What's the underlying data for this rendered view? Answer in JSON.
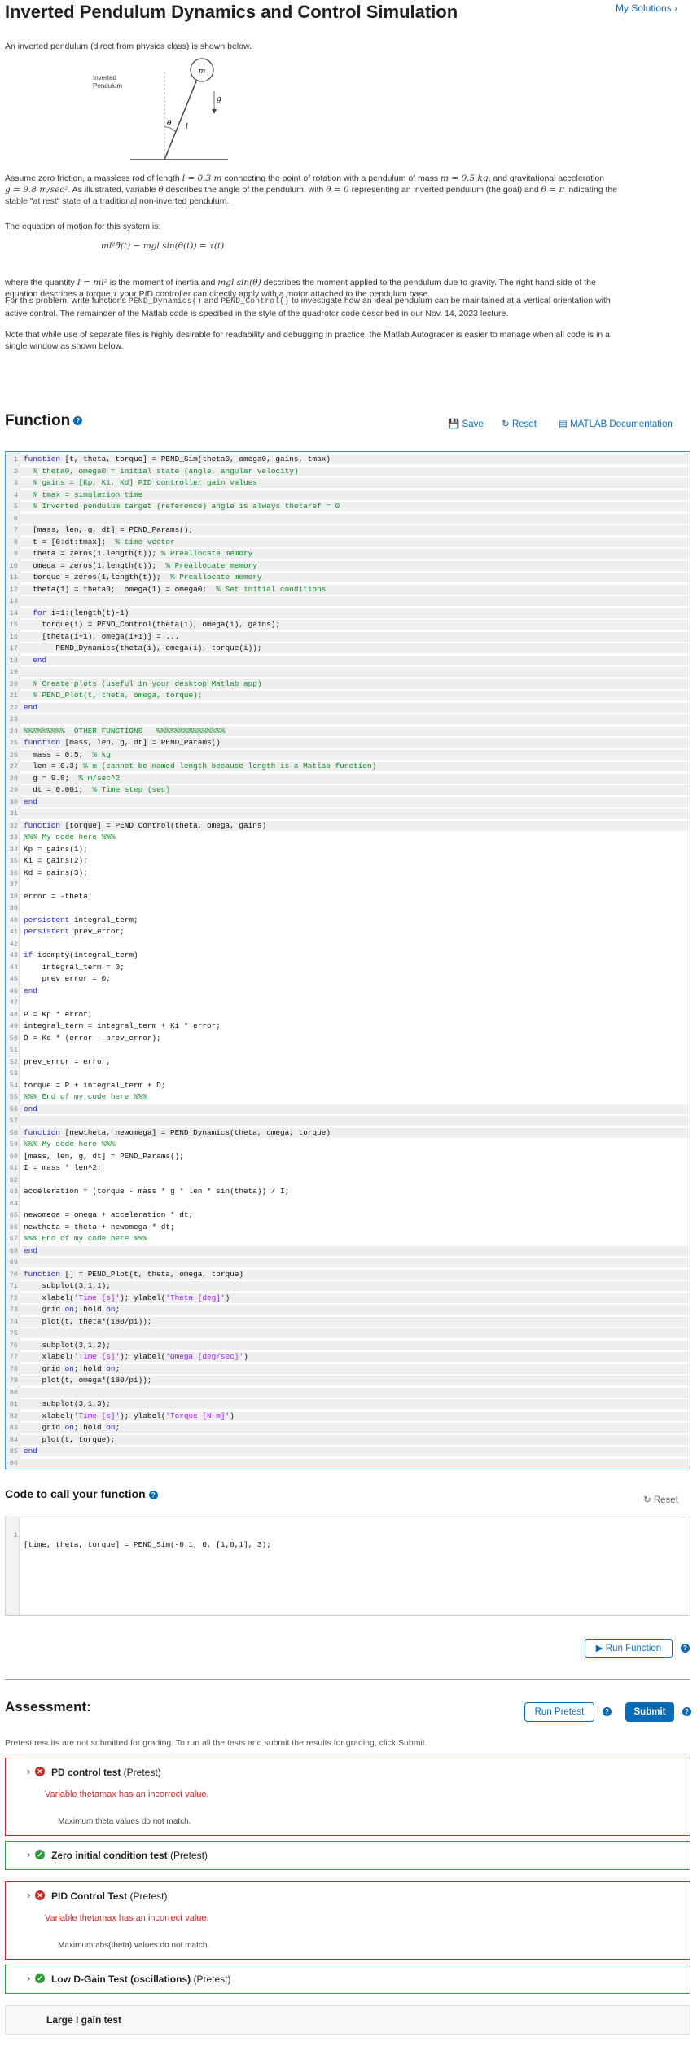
{
  "header": {
    "title": "Inverted Pendulum Dynamics and Control Simulation",
    "my_solutions": "My Solutions ›"
  },
  "intro": {
    "p1": "An inverted pendulum (direct from physics class) is shown below.",
    "figure_label": "Inverted\nPendulum",
    "fig_m": "m",
    "fig_g": "g",
    "fig_theta": "θ",
    "fig_l": "l",
    "p2a": "Assume zero friction, a massless rod of length ",
    "p2b": "l = 0.3 m",
    "p2c": " connecting the point of rotation with a pendulum of mass ",
    "p2d": "m = 0.5 kg",
    "p2e": ", and gravitational acceleration",
    "p2f": "g = 9.8 m/sec²",
    "p2g": ". As illustrated, variable ",
    "p2h": "θ",
    "p2i": " describes the angle of the pendulum, with ",
    "p2j": "θ = 0",
    "p2k": " representing an inverted pendulum (the goal) and ",
    "p2l": "θ = π",
    "p2m": " indicating the",
    "p2n": "stable \"at rest\" state of a traditional non-inverted pendulum.",
    "p3": "The  equation of motion for this system is:",
    "equation": "ml²θ̈(t) − mgl sin(θ(t)) = τ(t)",
    "p4a": "where the quantity ",
    "p4b": "I = ml²",
    "p4c": " is the moment of inertia and ",
    "p4d": "mgl sin(θ)",
    "p4e": " describes the moment applied to the pendulum due to gravity.  The right hand side of the",
    "p4f": "equation describes a torque ",
    "p4g": "τ",
    "p4h": " your PID controller can directly apply with a motor attached to the pendulum base.",
    "p5a": "For this problem, write functions ",
    "p5b": "PEND_Dynamics()",
    "p5c": " and ",
    "p5d": "PEND_Control()",
    "p5e": " to investigate how an ideal pendulum can be maintained at a vertical orientation with",
    "p5f": "active control.  The remainder of the Matlab code is specified in the style of the quadrotor code described in our Nov. 14, 2023 lecture.",
    "p6a": "Note that while use of separate files is highly desirable for readability and debugging in practice, the Matlab Autograder is easier to manage when all code is in a",
    "p6b": "single window as shown below."
  },
  "function_section": {
    "heading": "Function",
    "save": "Save",
    "reset": "Reset",
    "docs": "MATLAB Documentation"
  },
  "code_lines": [
    "function [t, theta, torque] = PEND_Sim(theta0, omega0, gains, tmax)",
    "  % theta0, omega0 = initial state (angle, angular velocity)",
    "  % gains = [Kp, Ki, Kd] PID controller gain values",
    "  % tmax = simulation time",
    "  % Inverted pendulum target (reference) angle is always thetaref = 0",
    "",
    "  [mass, len, g, dt] = PEND_Params();",
    "  t = [0:dt:tmax];  % time vector",
    "  theta = zeros(1,length(t)); % Preallocate memory",
    "  omega = zeros(1,length(t));  % Preallocate memory",
    "  torque = zeros(1,length(t));  % Preallocate memory",
    "  theta(1) = theta0;  omega(1) = omega0;  % Set initial conditions",
    "",
    "  for i=1:(length(t)-1)",
    "    torque(i) = PEND_Control(theta(i), omega(i), gains);",
    "    [theta(i+1), omega(i+1)] = ...",
    "       PEND_Dynamics(theta(i), omega(i), torque(i));",
    "  end",
    "",
    "  % Create plots (useful in your desktop Matlab app)",
    "  % PEND_Plot(t, theta, omega, torque);",
    "end",
    "",
    "%%%%%%%%%  OTHER FUNCTIONS   %%%%%%%%%%%%%%%",
    "function [mass, len, g, dt] = PEND_Params()",
    "  mass = 0.5;  % kg",
    "  len = 0.3; % m (cannot be named length because length is a Matlab function)",
    "  g = 9.8;  % m/sec^2",
    "  dt = 0.001;  % Time step (sec)",
    "end",
    "",
    "function [torque] = PEND_Control(theta, omega, gains)",
    "%%% My code here %%%",
    "Kp = gains(1);",
    "Ki = gains(2);",
    "Kd = gains(3);",
    "",
    "error = -theta;",
    "",
    "persistent integral_term;",
    "persistent prev_error;",
    "",
    "if isempty(integral_term)",
    "    integral_term = 0;",
    "    prev_error = 0;",
    "end",
    "",
    "P = Kp * error;",
    "integral_term = integral_term + Ki * error;",
    "D = Kd * (error - prev_error);",
    "",
    "prev_error = error;",
    "",
    "torque = P + integral_term + D;",
    "%%% End of my code here %%%",
    "end",
    "",
    "function [newtheta, newomega] = PEND_Dynamics(theta, omega, torque)",
    "%%% My code here %%%",
    "[mass, len, g, dt] = PEND_Params();",
    "I = mass * len^2;",
    "",
    "acceleration = (torque - mass * g * len * sin(theta)) / I;",
    "",
    "newomega = omega + acceleration * dt;",
    "newtheta = theta + newomega * dt;",
    "%%% End of my code here %%%",
    "end",
    "",
    "function [] = PEND_Plot(t, theta, omega, torque)",
    "    subplot(3,1,1);",
    "    xlabel('Time [s]'); ylabel('Theta [deg]')",
    "    grid on; hold on;",
    "    plot(t, theta*(180/pi));",
    "",
    "    subplot(3,1,2);",
    "    xlabel('Time [s]'); ylabel('Omega [deg/sec]')",
    "    grid on; hold on;",
    "    plot(t, omega*(180/pi));",
    "",
    "    subplot(3,1,3);",
    "    xlabel('Time [s]'); ylabel('Torque [N-m]')",
    "    grid on; hold on;",
    "    plot(t, torque);",
    "end",
    ""
  ],
  "readonly_ranges": [
    [
      1,
      32
    ],
    [
      56,
      58
    ],
    [
      68,
      86
    ]
  ],
  "call_section": {
    "heading": "Code to call your function",
    "reset": "Reset",
    "line": "[time, theta, torque] = PEND_Sim(-0.1, 0, [1,0,1], 3);",
    "line_number": "1",
    "run_button": "▶ Run Function"
  },
  "assessment": {
    "heading": "Assessment:",
    "run_pretest": "Run Pretest",
    "submit": "Submit",
    "note": "Pretest results are not submitted for grading. To run all the tests and submit the results for grading, click Submit.",
    "tests": [
      {
        "name": "PD control test",
        "tag": "(Pretest)",
        "status": "fail",
        "error": "Variable thetamax has an incorrect value.",
        "detail": "Maximum theta values do not match."
      },
      {
        "name": "Zero initial condition test",
        "tag": "(Pretest)",
        "status": "pass"
      },
      {
        "name": "PID Control Test",
        "tag": "(Pretest)",
        "status": "fail",
        "error": "Variable thetamax has an incorrect value.",
        "detail": "Maximum abs(theta) values do not match."
      },
      {
        "name": "Low D-Gain Test (oscillations)",
        "tag": "(Pretest)",
        "status": "pass"
      },
      {
        "name": "Large I gain test",
        "tag": "",
        "status": "none"
      }
    ]
  },
  "colors": {
    "accent": "#0b6bb5",
    "fail": "#c62828",
    "pass": "#2e9a3e",
    "keyword": "#1f2bd0",
    "comment": "#118a2a",
    "string": "#a020f0"
  }
}
